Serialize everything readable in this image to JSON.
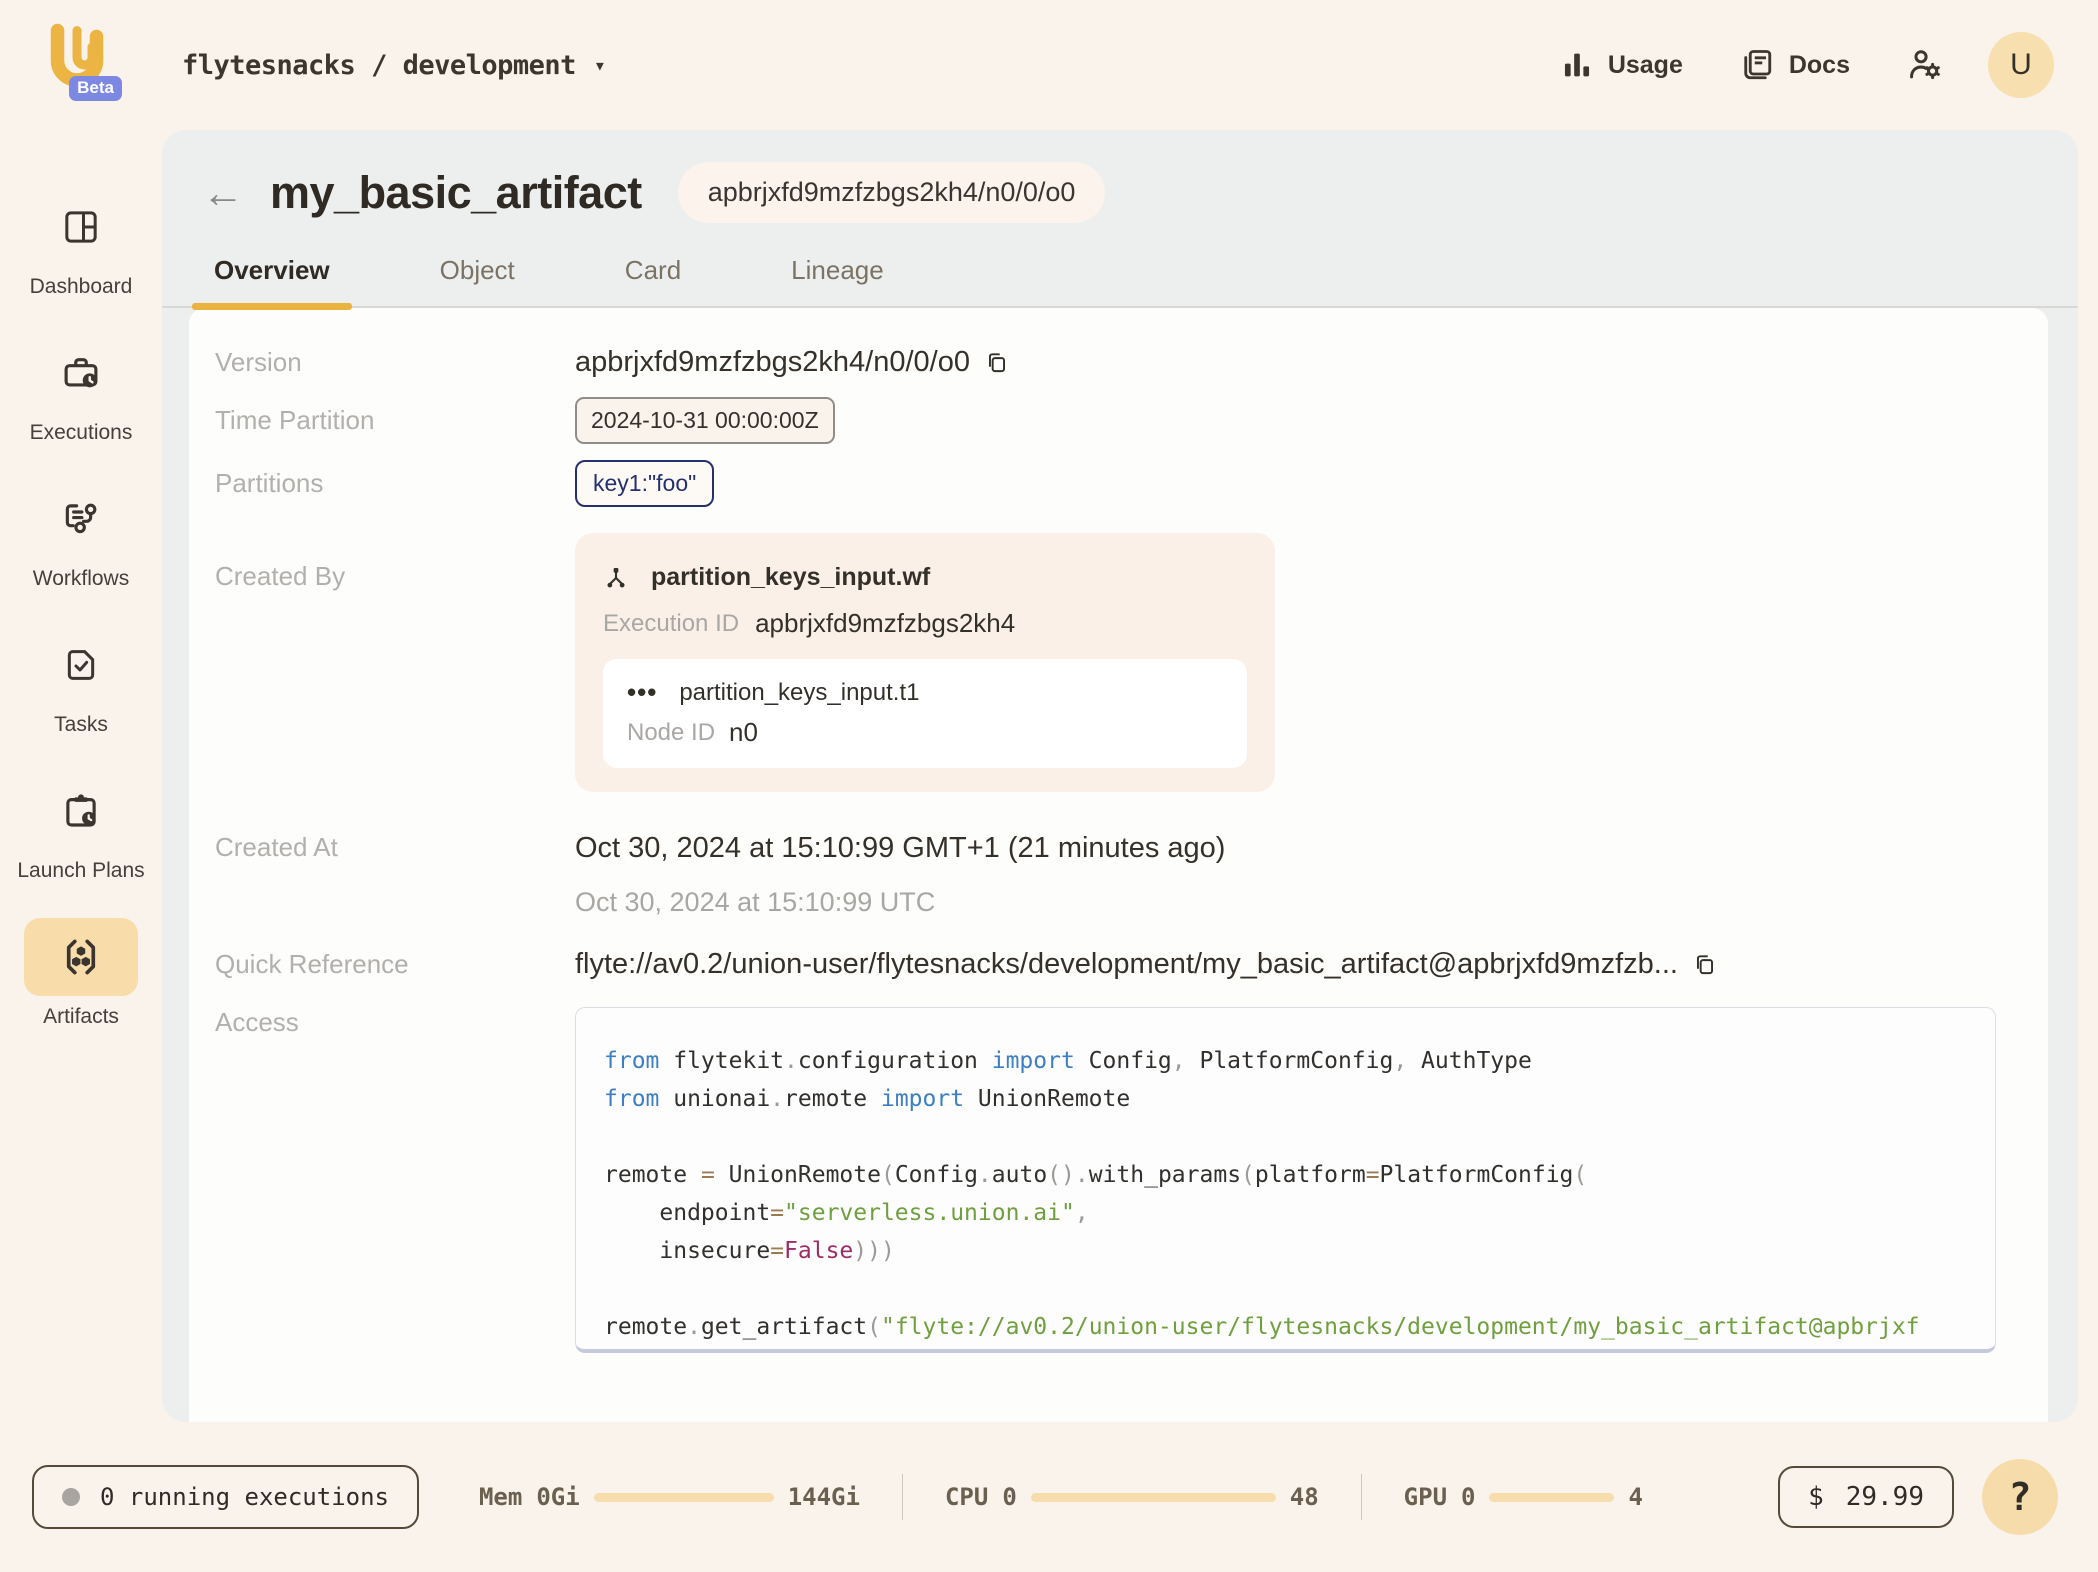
{
  "header": {
    "breadcrumb": "flytesnacks / development",
    "beta_label": "Beta",
    "usage_label": "Usage",
    "docs_label": "Docs",
    "avatar_initial": "U"
  },
  "sidebar": {
    "items": [
      {
        "label": "Dashboard"
      },
      {
        "label": "Executions"
      },
      {
        "label": "Workflows"
      },
      {
        "label": "Tasks"
      },
      {
        "label": "Launch Plans"
      },
      {
        "label": "Artifacts"
      }
    ]
  },
  "main": {
    "title": "my_basic_artifact",
    "title_badge": "apbrjxfd9mzfzbgs2kh4/n0/0/o0",
    "tabs": [
      {
        "label": "Overview"
      },
      {
        "label": "Object"
      },
      {
        "label": "Card"
      },
      {
        "label": "Lineage"
      }
    ],
    "details": {
      "version_label": "Version",
      "version_value": "apbrjxfd9mzfzbgs2kh4/n0/0/o0",
      "time_partition_label": "Time Partition",
      "time_partition_value": "2024-10-31 00:00:00Z",
      "partitions_label": "Partitions",
      "partitions_value": "key1:\"foo\"",
      "created_by_label": "Created By",
      "created_by": {
        "workflow_name": "partition_keys_input.wf",
        "execution_id_label": "Execution ID",
        "execution_id": "apbrjxfd9mzfzbgs2kh4",
        "task_name": "partition_keys_input.t1",
        "node_id_label": "Node ID",
        "node_id": "n0"
      },
      "created_at_label": "Created At",
      "created_at_primary": "Oct 30, 2024 at 15:10:99 GMT+1 (21 minutes ago)",
      "created_at_secondary": "Oct 30, 2024 at 15:10:99 UTC",
      "quick_reference_label": "Quick Reference",
      "quick_reference_value": "flyte://av0.2/union-user/flytesnacks/development/my_basic_artifact@apbrjxfd9mzfzb...",
      "access_label": "Access"
    },
    "access_code": {
      "lines": [
        [
          [
            "k",
            "from"
          ],
          [
            "t",
            " flytekit"
          ],
          [
            "p",
            "."
          ],
          [
            "t",
            "configuration"
          ],
          [
            "k",
            " import"
          ],
          [
            "t",
            " Config"
          ],
          [
            "p",
            ","
          ],
          [
            "t",
            " PlatformConfig"
          ],
          [
            "p",
            ","
          ],
          [
            "t",
            " AuthType"
          ]
        ],
        [
          [
            "k",
            "from"
          ],
          [
            "t",
            " unionai"
          ],
          [
            "p",
            "."
          ],
          [
            "t",
            "remote"
          ],
          [
            "k",
            " import"
          ],
          [
            "t",
            " UnionRemote"
          ]
        ],
        [],
        [
          [
            "t",
            "remote"
          ],
          [
            "o",
            " = "
          ],
          [
            "t",
            "UnionRemote"
          ],
          [
            "p",
            "("
          ],
          [
            "t",
            "Config"
          ],
          [
            "p",
            "."
          ],
          [
            "t",
            "auto"
          ],
          [
            "p",
            "()."
          ],
          [
            "t",
            "with_params"
          ],
          [
            "p",
            "("
          ],
          [
            "t",
            "platform"
          ],
          [
            "o",
            "="
          ],
          [
            "t",
            "PlatformConfig"
          ],
          [
            "p",
            "("
          ]
        ],
        [
          [
            "t",
            "    endpoint"
          ],
          [
            "o",
            "="
          ],
          [
            "s",
            "\"serverless.union.ai\""
          ],
          [
            "p",
            ","
          ]
        ],
        [
          [
            "t",
            "    insecure"
          ],
          [
            "o",
            "="
          ],
          [
            "b",
            "False"
          ],
          [
            "p",
            ")))"
          ]
        ],
        [],
        [
          [
            "t",
            "remote"
          ],
          [
            "p",
            "."
          ],
          [
            "t",
            "get_artifact"
          ],
          [
            "p",
            "("
          ],
          [
            "s",
            "\"flyte://av0.2/union-user/flytesnacks/development/my_basic_artifact@apbrjxf"
          ]
        ]
      ]
    }
  },
  "footer": {
    "running_executions": "0 running executions",
    "mem_label": "Mem",
    "mem_min": "0Gi",
    "mem_max": "144Gi",
    "cpu_label": "CPU",
    "cpu_min": "0",
    "cpu_max": "48",
    "gpu_label": "GPU",
    "gpu_min": "0",
    "gpu_max": "4",
    "cost_currency": "$",
    "cost_value": "29.99",
    "help_label": "?"
  },
  "colors": {
    "accent_gold": "#ecb442",
    "beta_blue": "#7d88e2",
    "partition_navy": "#25316e",
    "panel_gray": "#edefee",
    "page_cream": "#faf3ec"
  }
}
